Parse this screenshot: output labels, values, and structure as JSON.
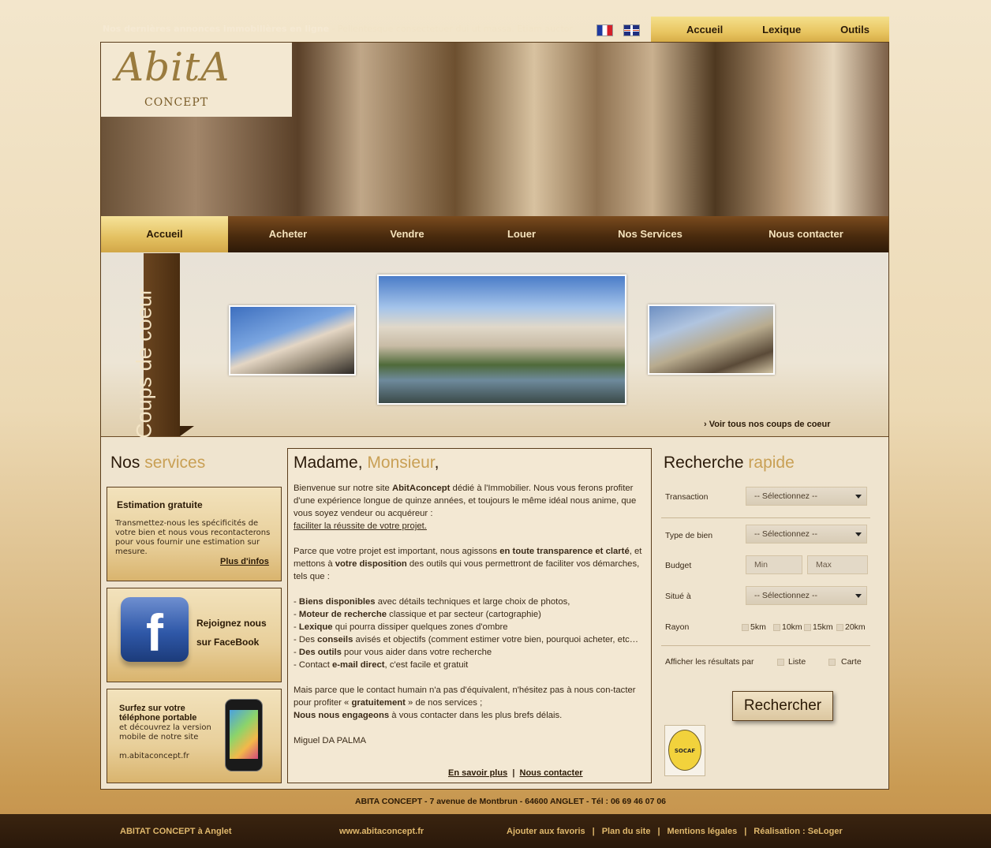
{
  "ticker": {
    "bold": "Nos dernières annonces immobilières en ligne",
    "text": " - Pellentesque consectetuer dui ut massa. Etiam auctor ...."
  },
  "top_menu": [
    "Accueil",
    "Lexique",
    "Outils"
  ],
  "logo": {
    "name": "AbitA",
    "sub": "CONCEPT"
  },
  "main_nav": [
    "Accueil",
    "Acheter",
    "Vendre",
    "Louer",
    "Nos Services",
    "Nous contacter"
  ],
  "coeur": {
    "title": "Coups de coeur",
    "link": "› Voir tous nos coups de coeur"
  },
  "services": {
    "title_a": "Nos",
    "title_b": "services",
    "estimation": {
      "title": "Estimation gratuite",
      "text": "Transmettez-nous les spécificités de votre bien et nous vous recontacterons pour vous fournir une estimation sur mesure.",
      "link": "Plus d'infos"
    },
    "facebook": {
      "line1": "Rejoignez nous",
      "line2": "sur FaceBook"
    },
    "mobile": {
      "title": "Surfez sur votre téléphone portable",
      "text": "et découvrez la version mobile de notre site",
      "url": "m.abitaconcept.fr"
    }
  },
  "welcome": {
    "title_a": "Madame,",
    "title_b": "Monsieur",
    "title_c": ",",
    "p1_a": "Bienvenue sur notre site ",
    "p1_b": "AbitAconcept",
    "p1_c": " dédié à l'Immobilier. Nous vous ferons profiter d'une expérience longue de  quinze années, et toujours le même idéal nous anime, que vous soyez vendeur ou acquéreur :",
    "p1_link": "faciliter la réussite de votre projet.",
    "p2_a": "Parce que votre projet est important, nous agissons ",
    "p2_b": "en toute transparence et clarté",
    "p2_c": ", et mettons à ",
    "p2_d": "votre disposition",
    "p2_e": " des outils qui vous permettront de faciliter vos démarches, tels que :",
    "list": [
      {
        "pre": "- ",
        "b": "Biens disponibles",
        "t": " avec détails techniques et large choix de photos,"
      },
      {
        "pre": "- ",
        "b": "Moteur de recherche",
        "t": " classique et par secteur (cartographie)"
      },
      {
        "pre": "- ",
        "b": "Lexique",
        "t": " qui pourra dissiper quelques zones d'ombre"
      },
      {
        "pre": "- Des ",
        "b": "conseils",
        "t": " avisés et objectifs (comment estimer votre bien, pourquoi acheter, etc…"
      },
      {
        "pre": "- ",
        "b": "Des outils",
        "t": " pour vous aider dans votre recherche"
      },
      {
        "pre": "- Contact ",
        "b": "e-mail direct",
        "t": ", c'est facile et gratuit"
      }
    ],
    "p3_a": "Mais parce que le contact humain n'a pas d'équivalent, n'hésitez pas à nous con-tacter pour profiter « ",
    "p3_b": "gratuitement",
    "p3_c": " » de nos services ;",
    "p3_d": "Nous nous engageons",
    "p3_e": " à vous contacter dans les plus brefs délais.",
    "signature": "Miguel DA PALMA",
    "link1": "En savoir plus",
    "link2": "Nous contacter"
  },
  "search": {
    "title_a": "Recherche",
    "title_b": "rapide",
    "transaction_label": "Transaction",
    "transaction_value": "-- Sélectionnez --",
    "type_label": "Type de bien",
    "type_value": "-- Sélectionnez --",
    "budget_label": "Budget",
    "min_placeholder": "Min",
    "max_placeholder": "Max",
    "situe_label": "Situé à",
    "situe_value": "-- Sélectionnez --",
    "rayon_label": "Rayon",
    "rayons": [
      "5km",
      "10km",
      "15km",
      "20km"
    ],
    "afficher_label": "Afficher les résultats par",
    "opt_liste": "Liste",
    "opt_carte": "Carte",
    "button": "Rechercher",
    "socaf": "SOCAF"
  },
  "address": "ABITA CONCEPT - 7 avenue de Montbrun - 64600 ANGLET - Tél : 06 69 46 07 06",
  "footer": {
    "left": "ABITAT CONCEPT à Anglet",
    "url": "www.abitaconcept.fr",
    "links": [
      "Ajouter aux favoris",
      "Plan du site",
      "Mentions légales",
      "Réalisation : SeLoger"
    ]
  }
}
